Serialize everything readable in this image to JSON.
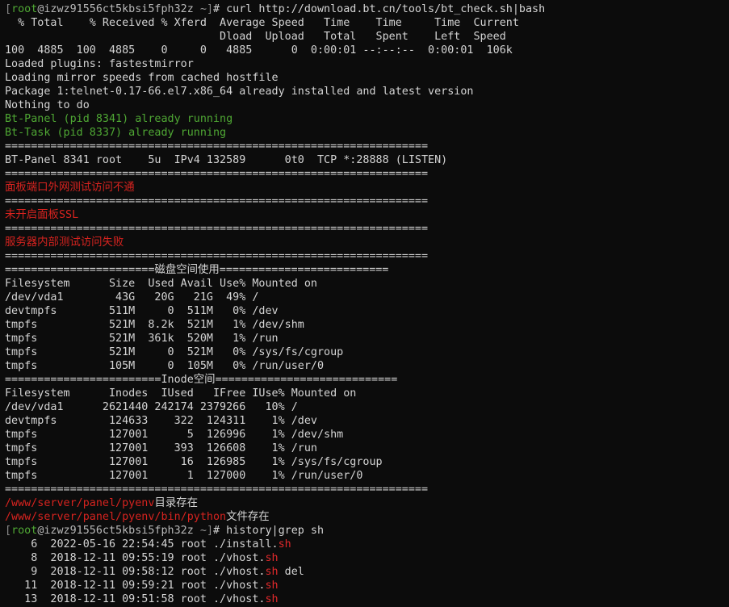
{
  "prompt": {
    "user": "root",
    "host": "izwz91556ct5kbsi5fph32z",
    "dir": "~"
  },
  "command1": "curl http://download.bt.cn/tools/bt_check.sh|bash",
  "curl_header1": "  % Total    % Received % Xferd  Average Speed   Time    Time     Time  Current",
  "curl_header2": "                                 Dload  Upload   Total   Spent    Left  Speed",
  "curl_progress": "100  4885  100  4885    0     0   4885      0  0:00:01 --:--:--  0:00:01  106k",
  "yum_lines": [
    "Loaded plugins: fastestmirror",
    "Loading mirror speeds from cached hostfile",
    "Package 1:telnet-0.17-66.el7.x86_64 already installed and latest version",
    "Nothing to do"
  ],
  "bt_status": [
    "Bt-Panel (pid 8341) already running",
    "Bt-Task (pid 8337) already running"
  ],
  "separator": "=================================================================",
  "lsof_line": "BT-Panel 8341 root    5u  IPv4 132589      0t0  TCP *:28888 (LISTEN)",
  "warn_external": "面板端口外网测试访问不通",
  "warn_ssl": "未开启面板SSL",
  "warn_internal": "服务器内部测试访问失败",
  "disk_title": "=======================磁盘空间使用==========================",
  "disk_rows": [
    "Filesystem      Size  Used Avail Use% Mounted on",
    "/dev/vda1        43G   20G   21G  49% /",
    "devtmpfs        511M     0  511M   0% /dev",
    "tmpfs           521M  8.2k  521M   1% /dev/shm",
    "tmpfs           521M  361k  520M   1% /run",
    "tmpfs           521M     0  521M   0% /sys/fs/cgroup",
    "tmpfs           105M     0  105M   0% /run/user/0"
  ],
  "inode_title": "========================Inode空间============================",
  "inode_rows": [
    "Filesystem      Inodes  IUsed   IFree IUse% Mounted on",
    "/dev/vda1      2621440 242174 2379266   10% /",
    "devtmpfs        124633    322  124311    1% /dev",
    "tmpfs           127001      5  126996    1% /dev/shm",
    "tmpfs           127001    393  126608    1% /run",
    "tmpfs           127001     16  126985    1% /sys/fs/cgroup",
    "tmpfs           127001      1  127000    1% /run/user/0"
  ],
  "pyenv_dir": {
    "path": "/www/server/panel/pyenv",
    "msg": "目录存在"
  },
  "pyenv_bin": {
    "path": "/www/server/panel/pyenv/bin/python",
    "msg": "文件存在"
  },
  "command2": "history|grep sh",
  "history": [
    {
      "prefix": "    6  2022-05-16 22:54:45 root ./install.",
      "hl": "sh",
      "suffix": ""
    },
    {
      "prefix": "    8  2018-12-11 09:55:19 root ./vhost.",
      "hl": "sh",
      "suffix": ""
    },
    {
      "prefix": "    9  2018-12-11 09:58:12 root ./vhost.",
      "hl": "sh",
      "suffix": " del"
    },
    {
      "prefix": "   11  2018-12-11 09:59:21 root ./vhost.",
      "hl": "sh",
      "suffix": ""
    },
    {
      "prefix": "   13  2018-12-11 09:51:58 root ./vhost.",
      "hl": "sh",
      "suffix": ""
    }
  ]
}
